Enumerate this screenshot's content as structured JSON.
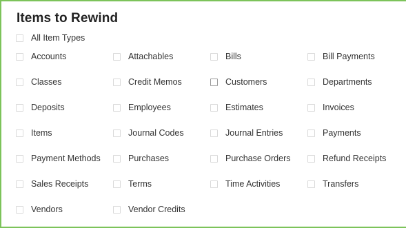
{
  "title": "Items to Rewind",
  "all_item_types": {
    "label": "All Item Types",
    "checked": false
  },
  "items": [
    {
      "label": "Accounts",
      "checked": false
    },
    {
      "label": "Attachables",
      "checked": false
    },
    {
      "label": "Bills",
      "checked": false
    },
    {
      "label": "Bill Payments",
      "checked": false
    },
    {
      "label": "Classes",
      "checked": false
    },
    {
      "label": "Credit Memos",
      "checked": false
    },
    {
      "label": "Customers",
      "checked": false
    },
    {
      "label": "Departments",
      "checked": false
    },
    {
      "label": "Deposits",
      "checked": false
    },
    {
      "label": "Employees",
      "checked": false
    },
    {
      "label": "Estimates",
      "checked": false
    },
    {
      "label": "Invoices",
      "checked": false
    },
    {
      "label": "Items",
      "checked": false
    },
    {
      "label": "Journal Codes",
      "checked": false
    },
    {
      "label": "Journal Entries",
      "checked": false
    },
    {
      "label": "Payments",
      "checked": false
    },
    {
      "label": "Payment Methods",
      "checked": false
    },
    {
      "label": "Purchases",
      "checked": false
    },
    {
      "label": "Purchase Orders",
      "checked": false
    },
    {
      "label": "Refund Receipts",
      "checked": false
    },
    {
      "label": "Sales Receipts",
      "checked": false
    },
    {
      "label": "Terms",
      "checked": false
    },
    {
      "label": "Time Activities",
      "checked": false
    },
    {
      "label": "Transfers",
      "checked": false
    },
    {
      "label": "Vendors",
      "checked": false
    },
    {
      "label": "Vendor Credits",
      "checked": false
    }
  ],
  "colors": {
    "panel_border": "#7cc35a",
    "checkbox_border": "#d9d9d9",
    "text": "#333333"
  }
}
